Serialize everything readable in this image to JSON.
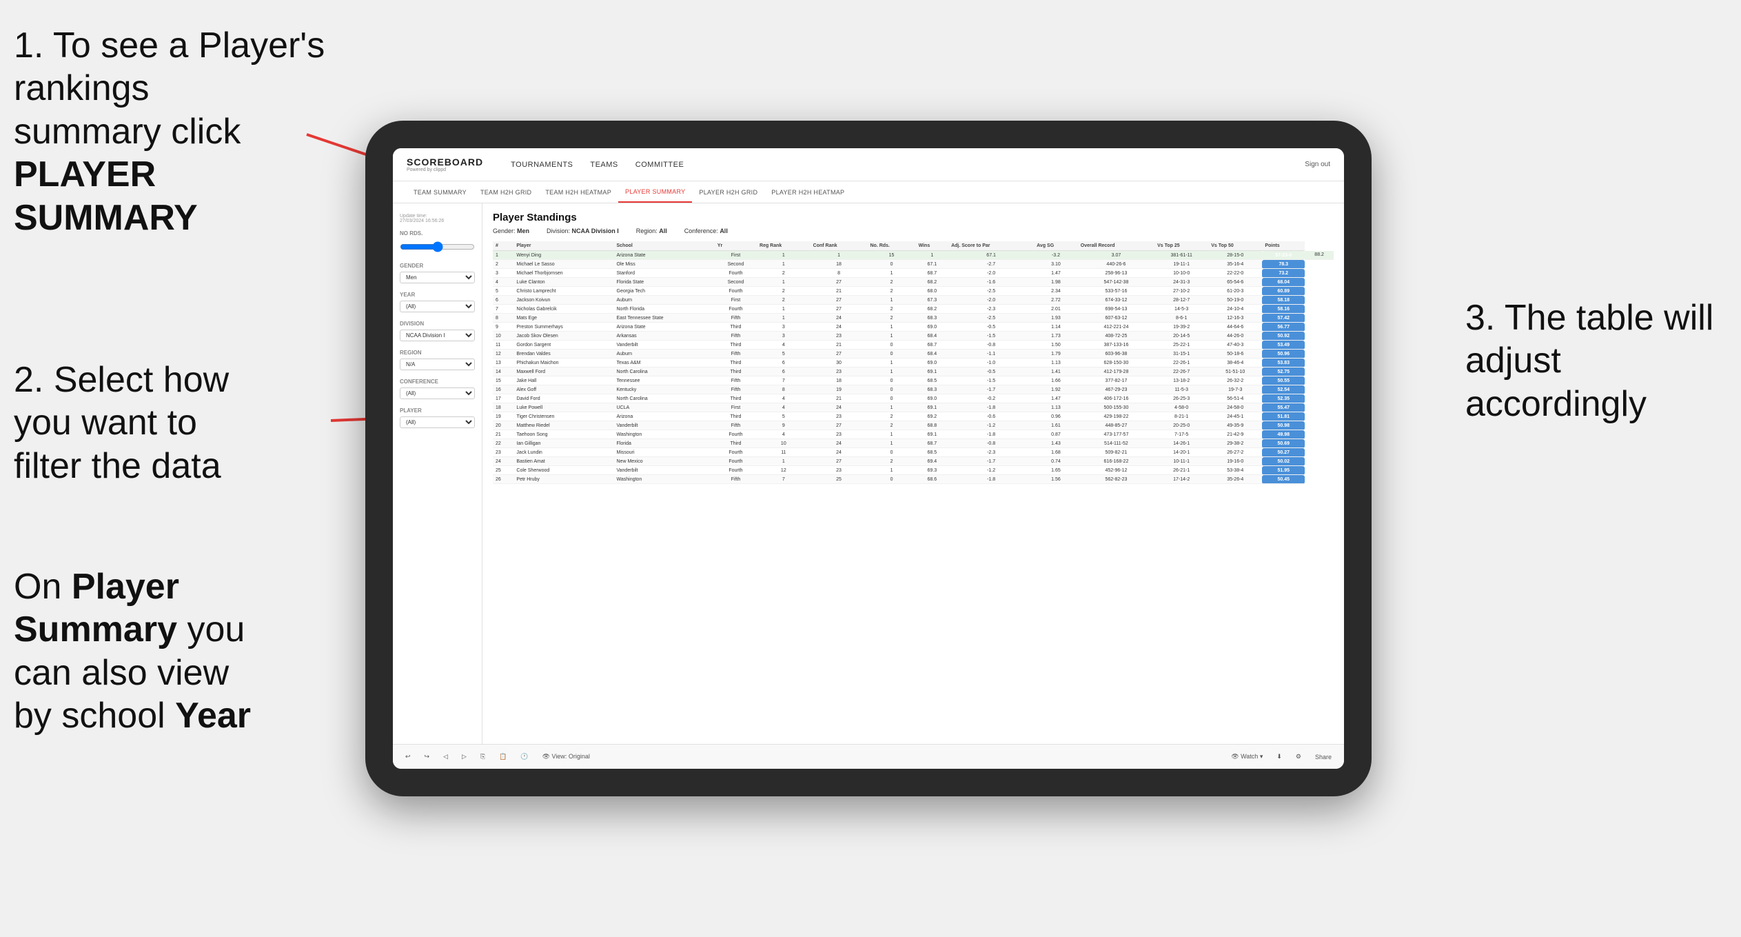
{
  "annotations": {
    "top_left": {
      "number": "1.",
      "line1": "To see a Player's rankings",
      "line2": "summary click ",
      "bold": "PLAYER SUMMARY"
    },
    "mid_left": {
      "number": "2.",
      "line1": "Select how you want to filter the data"
    },
    "bottom_left": {
      "line1": "On ",
      "bold1": "Player Summary",
      "line2": " you can also view by school ",
      "bold2": "Year"
    },
    "right": {
      "number": "3.",
      "line1": "The table will adjust accordingly"
    }
  },
  "nav": {
    "logo": "SCOREBOARD",
    "logo_sub": "Powered by clippd",
    "items": [
      "TOURNAMENTS",
      "TEAMS",
      "COMMITTEE"
    ],
    "sign_out": "Sign out"
  },
  "sub_nav": {
    "items": [
      "TEAM SUMMARY",
      "TEAM H2H GRID",
      "TEAM H2H HEATMAP",
      "PLAYER SUMMARY",
      "PLAYER H2H GRID",
      "PLAYER H2H HEATMAP"
    ]
  },
  "sidebar": {
    "update_label": "Update time:",
    "update_time": "27/03/2024 16:56:26",
    "no_rds_label": "No Rds.",
    "gender_label": "Gender",
    "gender_value": "Men",
    "year_label": "Year",
    "year_value": "(All)",
    "division_label": "Division",
    "division_value": "NCAA Division I",
    "region_label": "Region",
    "region_value": "N/A",
    "conference_label": "Conference",
    "conference_value": "(All)",
    "player_label": "Player",
    "player_value": "(All)"
  },
  "table": {
    "title": "Player Standings",
    "filters": {
      "gender_label": "Gender:",
      "gender_value": "Men",
      "division_label": "Division:",
      "division_value": "NCAA Division I",
      "region_label": "Region:",
      "region_value": "All",
      "conference_label": "Conference:",
      "conference_value": "All"
    },
    "columns": [
      "#",
      "Player",
      "School",
      "Yr",
      "Reg Rank",
      "Conf Rank",
      "No. Rds.",
      "Wins",
      "Adj. Score to Par",
      "Avg SG",
      "Overall Record",
      "Vs Top 25",
      "Vs Top 50",
      "Points"
    ],
    "rows": [
      [
        "1",
        "Wenyi Ding",
        "Arizona State",
        "First",
        "1",
        "1",
        "15",
        "1",
        "67.1",
        "-3.2",
        "3.07",
        "381-61-11",
        "28-15-0",
        "57-23-0",
        "88.2"
      ],
      [
        "2",
        "Michael Le Sasso",
        "Ole Miss",
        "Second",
        "1",
        "18",
        "0",
        "67.1",
        "-2.7",
        "3.10",
        "440-26-6",
        "19-11-1",
        "35-16-4",
        "78.3"
      ],
      [
        "3",
        "Michael Thorbjornsen",
        "Stanford",
        "Fourth",
        "2",
        "8",
        "1",
        "68.7",
        "-2.0",
        "1.47",
        "258-96-13",
        "10-10-0",
        "22-22-0",
        "73.2"
      ],
      [
        "4",
        "Luke Clanton",
        "Florida State",
        "Second",
        "1",
        "27",
        "2",
        "68.2",
        "-1.6",
        "1.98",
        "547-142-38",
        "24-31-3",
        "65-54-6",
        "68.04"
      ],
      [
        "5",
        "Christo Lamprecht",
        "Georgia Tech",
        "Fourth",
        "2",
        "21",
        "2",
        "68.0",
        "-2.5",
        "2.34",
        "533-57-16",
        "27-10-2",
        "61-20-3",
        "60.89"
      ],
      [
        "6",
        "Jackson Koivun",
        "Auburn",
        "First",
        "2",
        "27",
        "1",
        "67.3",
        "-2.0",
        "2.72",
        "674-33-12",
        "28-12-7",
        "50-19-0",
        "58.18"
      ],
      [
        "7",
        "Nicholas Gabrelcik",
        "North Florida",
        "Fourth",
        "1",
        "27",
        "2",
        "68.2",
        "-2.3",
        "2.01",
        "698-54-13",
        "14-5-3",
        "24-10-4",
        "58.16"
      ],
      [
        "8",
        "Mats Ege",
        "East Tennessee State",
        "Fifth",
        "1",
        "24",
        "2",
        "68.3",
        "-2.5",
        "1.93",
        "607-63-12",
        "8-6-1",
        "12-16-3",
        "57.42"
      ],
      [
        "9",
        "Preston Summerhays",
        "Arizona State",
        "Third",
        "3",
        "24",
        "1",
        "69.0",
        "-0.5",
        "1.14",
        "412-221-24",
        "19-39-2",
        "44-64-6",
        "56.77"
      ],
      [
        "10",
        "Jacob Skov Olesen",
        "Arkansas",
        "Fifth",
        "3",
        "23",
        "1",
        "68.4",
        "-1.5",
        "1.73",
        "408-72-25",
        "20-14-5",
        "44-26-0",
        "50.92"
      ],
      [
        "11",
        "Gordon Sargent",
        "Vanderbilt",
        "Third",
        "4",
        "21",
        "0",
        "68.7",
        "-0.8",
        "1.50",
        "387-133-16",
        "25-22-1",
        "47-40-3",
        "53.49"
      ],
      [
        "12",
        "Brendan Valdes",
        "Auburn",
        "Fifth",
        "5",
        "27",
        "0",
        "68.4",
        "-1.1",
        "1.79",
        "603-96-38",
        "31-15-1",
        "50-18-6",
        "50.96"
      ],
      [
        "13",
        "Phichakun Maichon",
        "Texas A&M",
        "Third",
        "6",
        "30",
        "1",
        "69.0",
        "-1.0",
        "1.13",
        "628-150-30",
        "22-26-1",
        "38-46-4",
        "53.83"
      ],
      [
        "14",
        "Maxwell Ford",
        "North Carolina",
        "Third",
        "6",
        "23",
        "1",
        "69.1",
        "-0.5",
        "1.41",
        "412-179-28",
        "22-26-7",
        "51-51-10",
        "52.75"
      ],
      [
        "15",
        "Jake Hall",
        "Tennessee",
        "Fifth",
        "7",
        "18",
        "0",
        "68.5",
        "-1.5",
        "1.66",
        "377-82-17",
        "13-18-2",
        "26-32-2",
        "50.55"
      ],
      [
        "16",
        "Alex Goff",
        "Kentucky",
        "Fifth",
        "8",
        "19",
        "0",
        "68.3",
        "-1.7",
        "1.92",
        "467-29-23",
        "11-5-3",
        "19-7-3",
        "52.54"
      ],
      [
        "17",
        "David Ford",
        "North Carolina",
        "Third",
        "4",
        "21",
        "0",
        "69.0",
        "-0.2",
        "1.47",
        "406-172-16",
        "26-25-3",
        "56-51-4",
        "52.35"
      ],
      [
        "18",
        "Luke Powell",
        "UCLA",
        "First",
        "4",
        "24",
        "1",
        "69.1",
        "-1.8",
        "1.13",
        "500-155-30",
        "4-58-0",
        "24-58-0",
        "55.47"
      ],
      [
        "19",
        "Tiger Christensen",
        "Arizona",
        "Third",
        "5",
        "23",
        "2",
        "69.2",
        "-0.6",
        "0.96",
        "429-198-22",
        "8-21-1",
        "24-45-1",
        "51.81"
      ],
      [
        "20",
        "Matthew Riedel",
        "Vanderbilt",
        "Fifth",
        "9",
        "27",
        "2",
        "68.8",
        "-1.2",
        "1.61",
        "448-85-27",
        "20-25-0",
        "49-35-9",
        "50.98"
      ],
      [
        "21",
        "Taehoon Song",
        "Washington",
        "Fourth",
        "4",
        "23",
        "1",
        "69.1",
        "-1.8",
        "0.87",
        "473-177-57",
        "7-17-5",
        "21-42-9",
        "49.98"
      ],
      [
        "22",
        "Ian Gilligan",
        "Florida",
        "Third",
        "10",
        "24",
        "1",
        "68.7",
        "-0.8",
        "1.43",
        "514-111-52",
        "14-26-1",
        "29-38-2",
        "50.69"
      ],
      [
        "23",
        "Jack Lundin",
        "Missouri",
        "Fourth",
        "11",
        "24",
        "0",
        "68.5",
        "-2.3",
        "1.68",
        "509-82-21",
        "14-20-1",
        "26-27-2",
        "50.27"
      ],
      [
        "24",
        "Bastien Amat",
        "New Mexico",
        "Fourth",
        "1",
        "27",
        "2",
        "69.4",
        "-1.7",
        "0.74",
        "616-168-22",
        "10-11-1",
        "19-16-0",
        "50.02"
      ],
      [
        "25",
        "Cole Sherwood",
        "Vanderbilt",
        "Fourth",
        "12",
        "23",
        "1",
        "69.3",
        "-1.2",
        "1.65",
        "452-96-12",
        "26-21-1",
        "53-38-4",
        "51.95"
      ],
      [
        "26",
        "Petr Hruby",
        "Washington",
        "Fifth",
        "7",
        "25",
        "0",
        "68.6",
        "-1.8",
        "1.56",
        "562-82-23",
        "17-14-2",
        "35-26-4",
        "50.45"
      ]
    ]
  },
  "toolbar": {
    "view_label": "View: Original",
    "watch_label": "Watch",
    "share_label": "Share"
  }
}
